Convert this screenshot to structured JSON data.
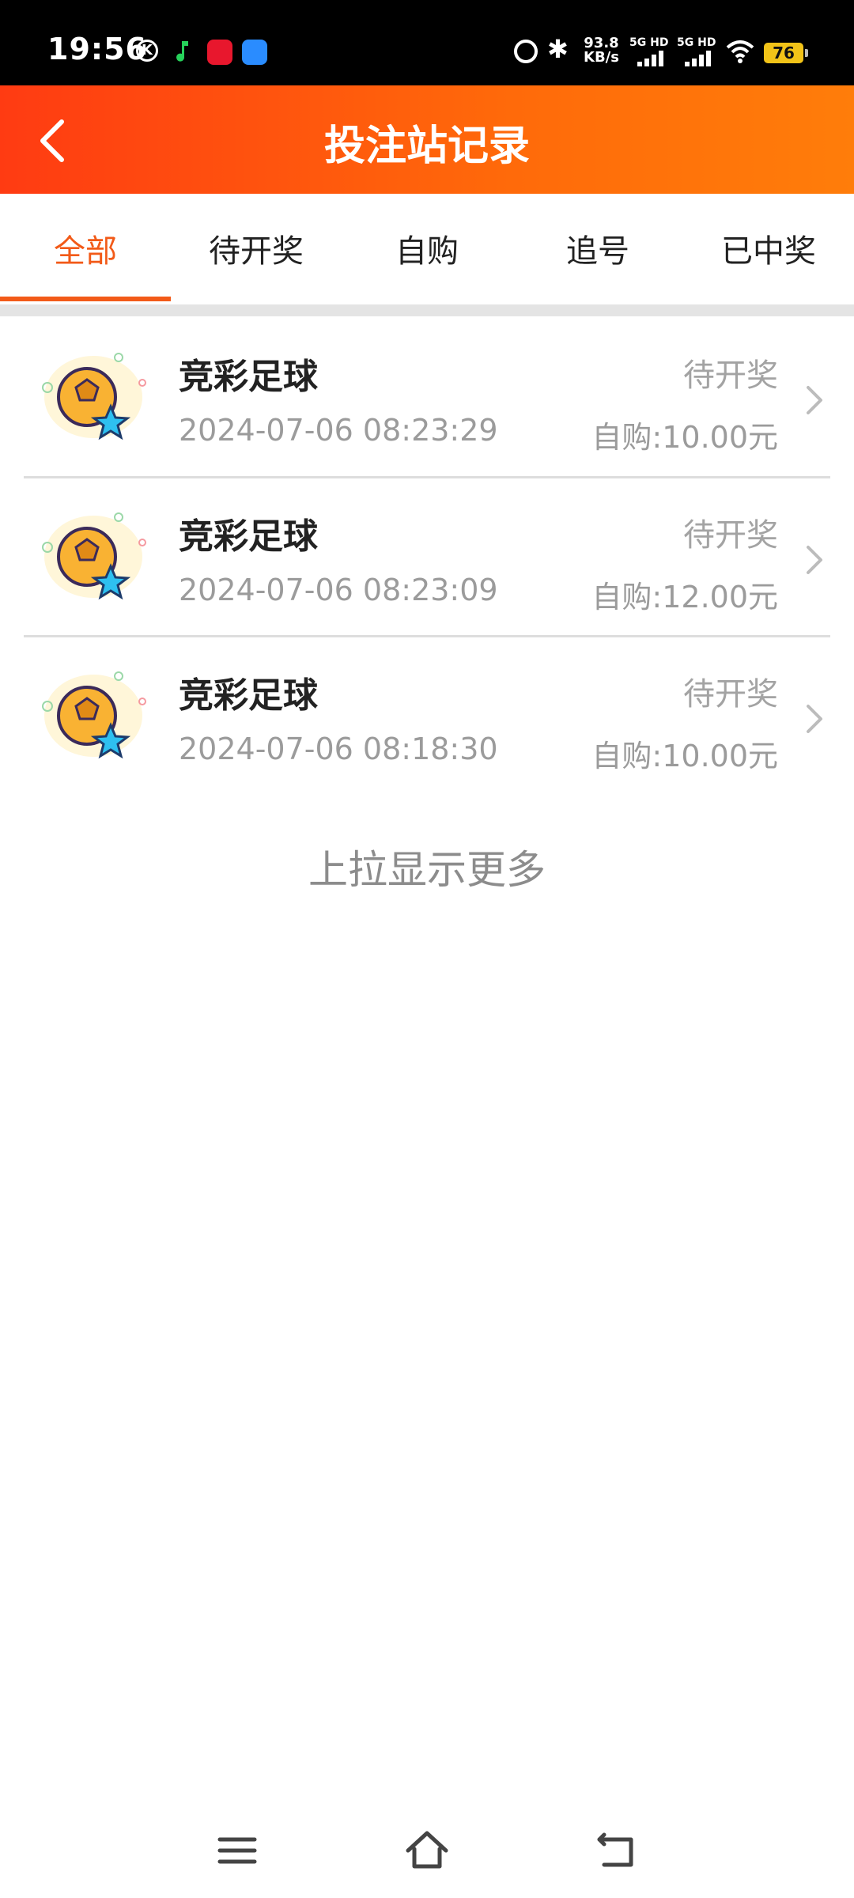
{
  "status_bar": {
    "time": "19:56",
    "k_icon": "K",
    "net_speed_value": "93.8",
    "net_speed_unit": "KB/s",
    "signal1": "5G HD",
    "signal2": "5G HD",
    "battery": "76"
  },
  "header": {
    "title": "投注站记录"
  },
  "tabs": [
    {
      "label": "全部"
    },
    {
      "label": "待开奖"
    },
    {
      "label": "自购"
    },
    {
      "label": "追号"
    },
    {
      "label": "已中奖"
    }
  ],
  "records": [
    {
      "title": "竞彩足球",
      "time": "2024-07-06 08:23:29",
      "status": "待开奖",
      "amount": "自购:10.00元"
    },
    {
      "title": "竞彩足球",
      "time": "2024-07-06 08:23:09",
      "status": "待开奖",
      "amount": "自购:12.00元"
    },
    {
      "title": "竞彩足球",
      "time": "2024-07-06 08:18:30",
      "status": "待开奖",
      "amount": "自购:10.00元"
    }
  ],
  "load_more": "上拉显示更多",
  "colors": {
    "accent": "#f25a18",
    "header_start": "#ff3b12",
    "header_end": "#ff7d0a"
  }
}
